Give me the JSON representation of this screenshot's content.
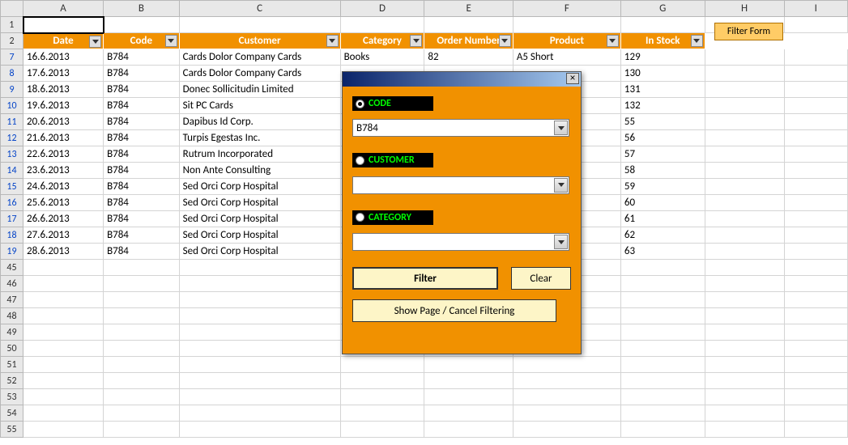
{
  "columns": [
    "",
    "A",
    "B",
    "C",
    "D",
    "E",
    "F",
    "G",
    "H",
    "I"
  ],
  "header": {
    "A": "Date",
    "B": "Code",
    "C": "Customer",
    "D": "Category",
    "E": "Order Number",
    "F": "Product",
    "G": "In Stock"
  },
  "rows": [
    {
      "n": "7",
      "date": "16.6.2013",
      "code": "B784",
      "customer": "Cards Dolor Company Cards",
      "category": "Books",
      "order": "82",
      "product": "A5 Short",
      "stock": "129"
    },
    {
      "n": "8",
      "date": "17.6.2013",
      "code": "B784",
      "customer": "Cards Dolor Company Cards",
      "category": "",
      "order": "",
      "product": "",
      "stock": "130"
    },
    {
      "n": "9",
      "date": "18.6.2013",
      "code": "B784",
      "customer": "Donec Sollicitudin Limited",
      "category": "",
      "order": "",
      "product": "",
      "stock": "131"
    },
    {
      "n": "10",
      "date": "19.6.2013",
      "code": "B784",
      "customer": "Sit PC Cards",
      "category": "",
      "order": "",
      "product": "",
      "stock": "132"
    },
    {
      "n": "11",
      "date": "20.6.2013",
      "code": "B784",
      "customer": "Dapibus Id Corp.",
      "category": "",
      "order": "",
      "product": "",
      "stock": "55"
    },
    {
      "n": "12",
      "date": "21.6.2013",
      "code": "B784",
      "customer": "Turpis Egestas Inc.",
      "category": "",
      "order": "",
      "product": "",
      "stock": "56"
    },
    {
      "n": "13",
      "date": "22.6.2013",
      "code": "B784",
      "customer": "Rutrum Incorporated",
      "category": "",
      "order": "",
      "product": "",
      "stock": "57"
    },
    {
      "n": "14",
      "date": "23.6.2013",
      "code": "B784",
      "customer": "Non Ante Consulting",
      "category": "",
      "order": "",
      "product": "",
      "stock": "58"
    },
    {
      "n": "15",
      "date": "24.6.2013",
      "code": "B784",
      "customer": "Sed Orci Corp Hospital",
      "category": "",
      "order": "",
      "product": "",
      "stock": "59"
    },
    {
      "n": "16",
      "date": "25.6.2013",
      "code": "B784",
      "customer": "Sed Orci Corp Hospital",
      "category": "",
      "order": "",
      "product": "",
      "stock": "60"
    },
    {
      "n": "17",
      "date": "26.6.2013",
      "code": "B784",
      "customer": "Sed Orci Corp Hospital",
      "category": "",
      "order": "",
      "product": "",
      "stock": "61"
    },
    {
      "n": "18",
      "date": "27.6.2013",
      "code": "B784",
      "customer": "Sed Orci Corp Hospital",
      "category": "",
      "order": "",
      "product": "",
      "stock": "62"
    },
    {
      "n": "19",
      "date": "28.6.2013",
      "code": "B784",
      "customer": "Sed Orci Corp Hospital",
      "category": "",
      "order": "",
      "product": "",
      "stock": "63"
    }
  ],
  "empty_rows": [
    "45",
    "46",
    "47",
    "48",
    "49",
    "50",
    "51",
    "52",
    "53",
    "54",
    "55"
  ],
  "filter_form_button": "Filter Form",
  "dialog": {
    "code_label": "CODE",
    "customer_label": "CUSTOMER",
    "category_label": "CATEGORY",
    "code_value": "B784",
    "customer_value": "",
    "category_value": "",
    "filter_btn": "Filter",
    "clear_btn": "Clear",
    "show_btn": "Show Page / Cancel Filtering",
    "close_x": "×"
  }
}
